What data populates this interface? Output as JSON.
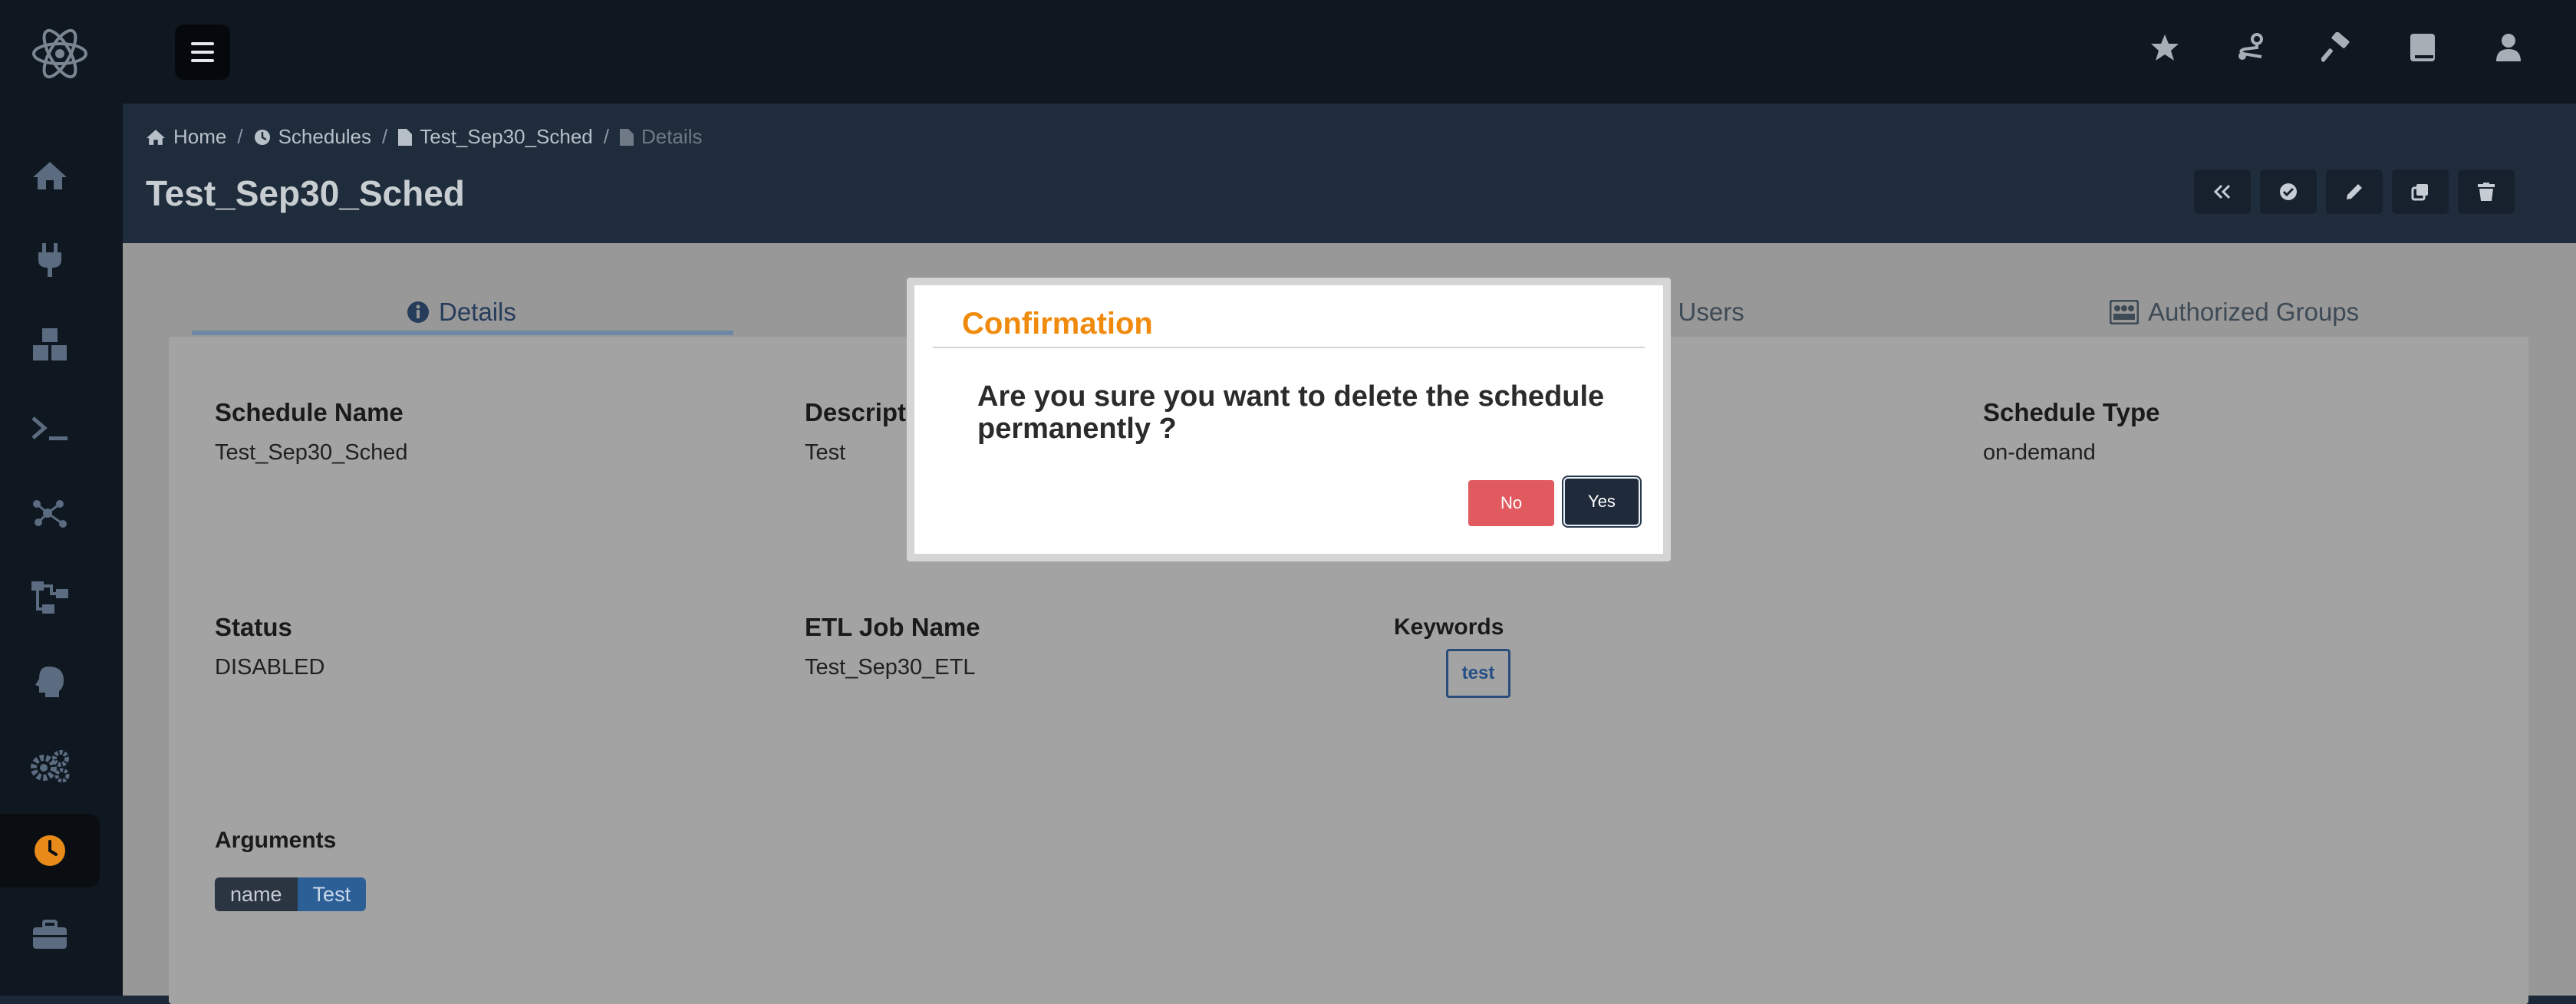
{
  "colors": {
    "accent_orange": "#f08a0c",
    "nav_dark": "#0f1720",
    "no_button": "#e05a5f",
    "yes_button": "#1f2b3a"
  },
  "topbar": {
    "icons": [
      "star-icon",
      "route-icon",
      "hammer-icon",
      "book-icon",
      "user-icon"
    ]
  },
  "sidebar": {
    "items": [
      "home-icon",
      "plug-icon",
      "boxes-icon",
      "terminal-icon",
      "network-icon",
      "sitemap-icon",
      "brain-icon",
      "cogs-icon",
      "clock-icon",
      "briefcase-icon"
    ],
    "active_item": "clock-icon"
  },
  "breadcrumb": {
    "home": "Home",
    "schedules": "Schedules",
    "schedule": "Test_Sep30_Sched",
    "current": "Details"
  },
  "page": {
    "title": "Test_Sep30_Sched"
  },
  "tabs": {
    "details": "Details",
    "authorized_users_partial": "d Users",
    "authorized_groups": "Authorized Groups"
  },
  "details": {
    "schedule_name_label": "Schedule Name",
    "schedule_name": "Test_Sep30_Sched",
    "description_label_partial": "Descripti",
    "description": "Test",
    "schedule_type_label": "Schedule Type",
    "schedule_type": "on-demand",
    "status_label": "Status",
    "status": "DISABLED",
    "etl_job_label": "ETL Job Name",
    "etl_job": "Test_Sep30_ETL",
    "keywords_label": "Keywords",
    "keyword": "test",
    "arguments_label": "Arguments",
    "arg_key": "name",
    "arg_value": "Test"
  },
  "modal": {
    "title": "Confirmation",
    "message": "Are you sure you want to delete the schedule permanently ?",
    "no_label": "No",
    "yes_label": "Yes"
  }
}
